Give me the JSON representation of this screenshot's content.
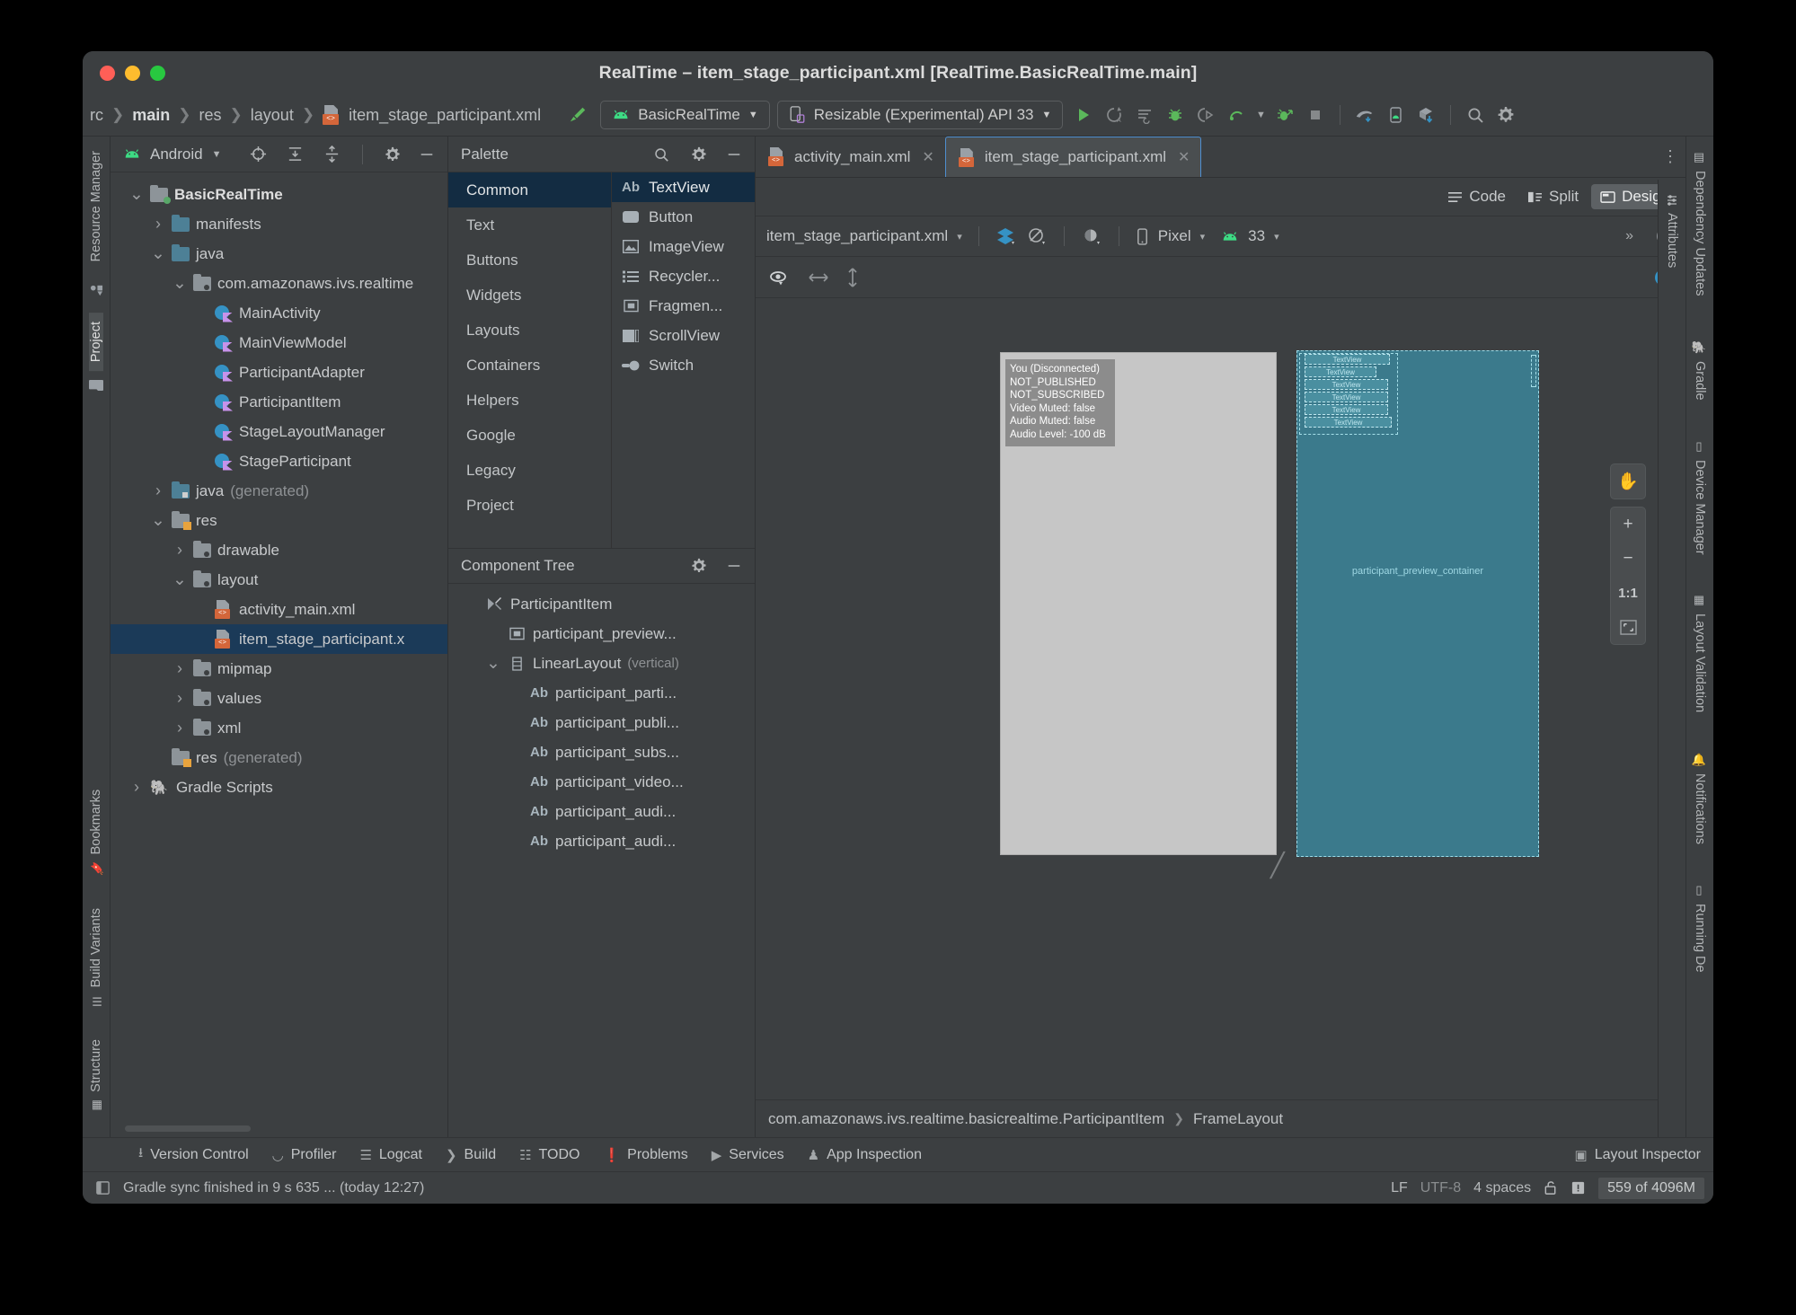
{
  "window": {
    "title": "RealTime – item_stage_participant.xml [RealTime.BasicRealTime.main]"
  },
  "navbar": {
    "breadcrumbs": [
      "rc",
      "main",
      "res",
      "layout",
      "item_stage_participant.xml"
    ],
    "run_config": "BasicRealTime",
    "device": "Resizable (Experimental) API 33",
    "icons": [
      "build-hammer-icon",
      "run-icon",
      "run-with-coverage-icon",
      "edit-config-icon",
      "debug-icon",
      "attach-debugger-icon",
      "profile-icon",
      "profile-dropdown-icon",
      "app-inspection-run-icon",
      "stop-icon",
      "gradle-sync-icon",
      "device-manager-icon",
      "sdk-manager-icon",
      "search-everywhere-icon",
      "settings-icon"
    ]
  },
  "left_strip": {
    "tabs": [
      "Resource Manager",
      "Project",
      "Bookmarks",
      "Build Variants",
      "Structure"
    ]
  },
  "right_strip": {
    "tabs": [
      "Dependency Updates",
      "Gradle",
      "Device Manager",
      "Layout Validation",
      "Notifications",
      "Running De"
    ]
  },
  "project": {
    "header": {
      "title": "Android",
      "icons": [
        "android-icon",
        "chevron-down-icon",
        "select-opened-file-icon",
        "expand-all-icon",
        "collapse-all-icon",
        "gear-icon",
        "minimize-icon"
      ]
    },
    "tree": [
      {
        "label": "BasicRealTime",
        "indent": 0,
        "arrow": "down",
        "icon": "module-folder-icon",
        "bold": true
      },
      {
        "label": "manifests",
        "indent": 1,
        "arrow": "right",
        "icon": "folder-icon"
      },
      {
        "label": "java",
        "indent": 1,
        "arrow": "down",
        "icon": "folder-icon"
      },
      {
        "label": "com.amazonaws.ivs.realtime",
        "indent": 2,
        "arrow": "down",
        "icon": "package-folder-icon"
      },
      {
        "label": "MainActivity",
        "indent": 3,
        "arrow": "none",
        "icon": "kotlin-class-icon"
      },
      {
        "label": "MainViewModel",
        "indent": 3,
        "arrow": "none",
        "icon": "kotlin-class-icon"
      },
      {
        "label": "ParticipantAdapter",
        "indent": 3,
        "arrow": "none",
        "icon": "kotlin-class-icon"
      },
      {
        "label": "ParticipantItem",
        "indent": 3,
        "arrow": "none",
        "icon": "kotlin-class-icon"
      },
      {
        "label": "StageLayoutManager",
        "indent": 3,
        "arrow": "none",
        "icon": "kotlin-class-icon"
      },
      {
        "label": "StageParticipant",
        "indent": 3,
        "arrow": "none",
        "icon": "kotlin-class-icon"
      },
      {
        "label": "java",
        "suffix": "(generated)",
        "indent": 1,
        "arrow": "right",
        "icon": "generated-folder-icon"
      },
      {
        "label": "res",
        "indent": 1,
        "arrow": "down",
        "icon": "res-folder-icon"
      },
      {
        "label": "drawable",
        "indent": 2,
        "arrow": "right",
        "icon": "package-folder-icon"
      },
      {
        "label": "layout",
        "indent": 2,
        "arrow": "down",
        "icon": "package-folder-icon"
      },
      {
        "label": "activity_main.xml",
        "indent": 3,
        "arrow": "none",
        "icon": "xml-layout-icon"
      },
      {
        "label": "item_stage_participant.x",
        "indent": 3,
        "arrow": "none",
        "icon": "xml-layout-icon",
        "selected": true
      },
      {
        "label": "mipmap",
        "indent": 2,
        "arrow": "right",
        "icon": "package-folder-icon"
      },
      {
        "label": "values",
        "indent": 2,
        "arrow": "right",
        "icon": "package-folder-icon"
      },
      {
        "label": "xml",
        "indent": 2,
        "arrow": "right",
        "icon": "package-folder-icon"
      },
      {
        "label": "res",
        "suffix": "(generated)",
        "indent": 1,
        "arrow": "none",
        "icon": "res-folder-icon"
      },
      {
        "label": "Gradle Scripts",
        "indent": 0,
        "arrow": "right",
        "icon": "gradle-elephant-icon"
      }
    ]
  },
  "palette": {
    "title": "Palette",
    "icons": [
      "search-icon",
      "gear-icon",
      "minimize-icon"
    ],
    "categories": [
      "Common",
      "Text",
      "Buttons",
      "Widgets",
      "Layouts",
      "Containers",
      "Helpers",
      "Google",
      "Legacy",
      "Project"
    ],
    "active_category": "Common",
    "items": [
      {
        "label": "TextView",
        "icon": "ab-text-icon",
        "active": true
      },
      {
        "label": "Button",
        "icon": "button-icon"
      },
      {
        "label": "ImageView",
        "icon": "image-icon"
      },
      {
        "label": "Recycler...",
        "icon": "list-icon"
      },
      {
        "label": "Fragmen...",
        "icon": "fragment-icon"
      },
      {
        "label": "ScrollView",
        "icon": "scrollview-icon"
      },
      {
        "label": "Switch",
        "icon": "switch-icon"
      }
    ]
  },
  "component_tree": {
    "title": "Component Tree",
    "icons": [
      "gear-icon",
      "minimize-icon"
    ],
    "nodes": [
      {
        "label": "ParticipantItem",
        "indent": 0,
        "arrow": "none",
        "icon": "merge-icon"
      },
      {
        "label": "participant_preview...",
        "indent": 1,
        "arrow": "none",
        "icon": "framelayout-icon"
      },
      {
        "label": "LinearLayout",
        "suffix": "(vertical)",
        "indent": 1,
        "arrow": "down",
        "icon": "linearlayout-icon"
      },
      {
        "label": "participant_parti...",
        "indent": 2,
        "arrow": "none",
        "icon": "ab-text-icon"
      },
      {
        "label": "participant_publi...",
        "indent": 2,
        "arrow": "none",
        "icon": "ab-text-icon"
      },
      {
        "label": "participant_subs...",
        "indent": 2,
        "arrow": "none",
        "icon": "ab-text-icon"
      },
      {
        "label": "participant_video...",
        "indent": 2,
        "arrow": "none",
        "icon": "ab-text-icon"
      },
      {
        "label": "participant_audi...",
        "indent": 2,
        "arrow": "none",
        "icon": "ab-text-icon"
      },
      {
        "label": "participant_audi...",
        "indent": 2,
        "arrow": "none",
        "icon": "ab-text-icon"
      }
    ]
  },
  "editor": {
    "tabs": [
      {
        "label": "activity_main.xml",
        "active": false,
        "icon": "xml-layout-icon"
      },
      {
        "label": "item_stage_participant.xml",
        "active": true,
        "icon": "xml-layout-icon"
      }
    ],
    "modes": [
      {
        "label": "Code",
        "active": false,
        "icon": "code-view-icon"
      },
      {
        "label": "Split",
        "active": false,
        "icon": "split-view-icon"
      },
      {
        "label": "Design",
        "active": true,
        "icon": "design-view-icon"
      }
    ]
  },
  "design_toolbar": {
    "file": "item_stage_participant.xml",
    "device": "Pixel",
    "api": "33",
    "icons": [
      "layers-icon",
      "orientation-icon",
      "theme-icon",
      "device-icon",
      "android-api-icon",
      "overflow-icon",
      "issue-icon"
    ],
    "second_row_icons": [
      "eye-visibility-icon",
      "horizontal-resize-icon",
      "vertical-resize-icon",
      "help-icon"
    ]
  },
  "canvas": {
    "overlay_lines": [
      "You (Disconnected)",
      "NOT_PUBLISHED",
      "NOT_SUBSCRIBED",
      "Video Muted: false",
      "Audio Muted: false",
      "Audio Level: -100 dB"
    ],
    "blueprint_textviews": [
      "TextView",
      "TextView",
      "TextView",
      "TextView",
      "TextView",
      "TextView"
    ],
    "blueprint_label": "participant_preview_container",
    "zoom_controls": [
      {
        "label": "",
        "icon": "pan-hand-icon"
      },
      {
        "label": "+",
        "icon": "zoom-in-icon"
      },
      {
        "label": "−",
        "icon": "zoom-out-icon"
      },
      {
        "label": "1:1",
        "icon": "zoom-actual-icon"
      },
      {
        "label": "",
        "icon": "zoom-to-fit-icon"
      }
    ]
  },
  "bottom_breadcrumb": {
    "parts": [
      "com.amazonaws.ivs.realtime.basicrealtime.ParticipantItem",
      "FrameLayout"
    ]
  },
  "tool_windows": {
    "left_items": [
      {
        "label": "Version Control",
        "icon": "branch-icon"
      },
      {
        "label": "Profiler",
        "icon": "profiler-icon"
      },
      {
        "label": "Logcat",
        "icon": "logcat-icon"
      },
      {
        "label": "Build",
        "icon": "build-hammer-icon"
      },
      {
        "label": "TODO",
        "icon": "todo-icon"
      },
      {
        "label": "Problems",
        "icon": "problems-icon"
      },
      {
        "label": "Services",
        "icon": "services-icon"
      },
      {
        "label": "App Inspection",
        "icon": "app-inspection-icon"
      }
    ],
    "right_items": [
      {
        "label": "Layout Inspector",
        "icon": "layout-inspector-icon"
      }
    ]
  },
  "status_bar": {
    "message": "Gradle sync finished in 9 s 635 ... (today 12:27)",
    "line_separator": "LF",
    "encoding": "UTF-8",
    "indent": "4 spaces",
    "memory": "559 of 4096M",
    "icons": [
      "status-toggle-icon",
      "lock-icon",
      "notification-icon"
    ]
  },
  "colors": {
    "accent_blue": "#4f8fd0",
    "selection_blue": "#1b3a58",
    "panel_bg": "#3c3f41",
    "blueprint": "#3b7a8c",
    "android_green": "#3ddc84"
  }
}
